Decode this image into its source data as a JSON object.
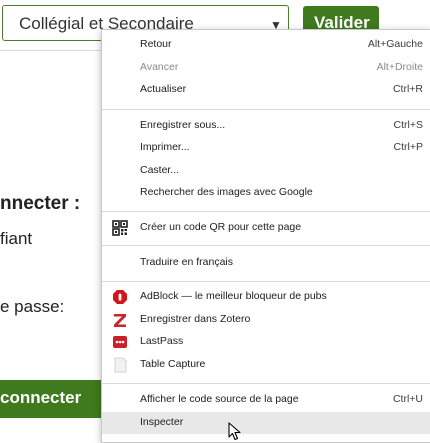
{
  "page": {
    "select_value": "Collégial et Secondaire",
    "validate_label": "Valider",
    "login_heading": "nnecter :",
    "identifier_label": "fiant",
    "password_label": "e passe:",
    "connect_label": "connecter"
  },
  "menu": {
    "groups": [
      [
        {
          "label": "Retour",
          "shortcut": "Alt+Gauche"
        },
        {
          "label": "Avancer",
          "shortcut": "Alt+Droite",
          "disabled": true
        },
        {
          "label": "Actualiser",
          "shortcut": "Ctrl+R"
        }
      ],
      [
        {
          "label": "Enregistrer sous...",
          "shortcut": "Ctrl+S"
        },
        {
          "label": "Imprimer...",
          "shortcut": "Ctrl+P"
        },
        {
          "label": "Caster...",
          "shortcut": ""
        },
        {
          "label": "Rechercher des images avec Google",
          "shortcut": ""
        }
      ],
      [
        {
          "label": "Créer un code QR pour cette page",
          "icon": "qr-code-icon"
        }
      ],
      [
        {
          "label": "Traduire en français"
        }
      ],
      [
        {
          "label": "AdBlock — le meilleur bloqueur de pubs",
          "icon": "adblock-icon"
        },
        {
          "label": "Enregistrer dans Zotero",
          "icon": "zotero-icon"
        },
        {
          "label": "LastPass",
          "icon": "lastpass-icon"
        },
        {
          "label": "Table Capture",
          "icon": "table-capture-icon"
        }
      ],
      [
        {
          "label": "Afficher le code source de la page",
          "shortcut": "Ctrl+U"
        },
        {
          "label": "Inspecter",
          "highlighted": true
        }
      ]
    ]
  },
  "colors": {
    "brand_green": "#3f7a1e",
    "adblock_red": "#d2161c",
    "zotero_red": "#c6262e",
    "lastpass_red": "#cc2029"
  }
}
